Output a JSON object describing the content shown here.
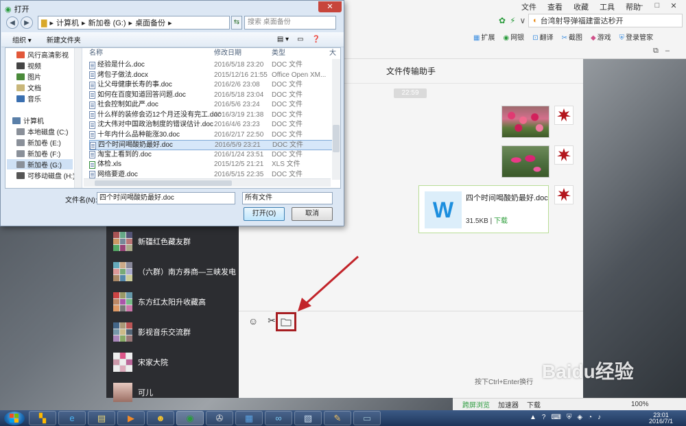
{
  "browser": {
    "menu": [
      "文件",
      "查看",
      "收藏",
      "工具",
      "帮助"
    ],
    "address": "台湾射导弹福建雷达秒开",
    "toolbar": [
      "扩展",
      "网银",
      "翻译",
      "截图",
      "游戏",
      "登录管家"
    ]
  },
  "chat": {
    "title": "文件传输助手",
    "time": "22:59",
    "file_name": "四个时间喝酸奶最好.doc",
    "file_size": "31.5KB |",
    "download": "下载",
    "hint": "按下Ctrl+Enter换行"
  },
  "contacts": [
    {
      "name": "新疆红色藏友群"
    },
    {
      "name": "（六群）南方券商—三峡发电"
    },
    {
      "name": "东方红太阳升收藏高"
    },
    {
      "name": "影视音乐交流群"
    },
    {
      "name": "宋家大院"
    },
    {
      "name": "可儿"
    }
  ],
  "dialog": {
    "title": "打开",
    "path": [
      "计算机",
      "新加卷 (G:)",
      "桌面备份"
    ],
    "search_placeholder": "搜索 桌面备份",
    "organize": "组织 ▾",
    "new_folder": "新建文件夹",
    "nav_items": [
      "风行高清影视",
      "视频",
      "图片",
      "文档",
      "音乐",
      "计算机",
      "本地磁盘 (C:)",
      "新加卷 (E:)",
      "新加卷 (F:)",
      "新加卷 (G:)",
      "可移动磁盘 (H:)"
    ],
    "columns": {
      "name": "名称",
      "date": "修改日期",
      "type": "类型",
      "size": "大"
    },
    "files": [
      {
        "name": "经验是什么.doc",
        "date": "2016/5/18 23:20",
        "type": "DOC 文件"
      },
      {
        "name": "烤包子做法.docx",
        "date": "2015/12/16 21:55",
        "type": "Office Open XM..."
      },
      {
        "name": "让父母健康长寿的事.doc",
        "date": "2016/2/6 23:08",
        "type": "DOC 文件"
      },
      {
        "name": "如何在百度知道回答问题.doc",
        "date": "2016/5/18 23:04",
        "type": "DOC 文件"
      },
      {
        "name": "社会控制如此严.doc",
        "date": "2016/5/6 23:24",
        "type": "DOC 文件"
      },
      {
        "name": "什么样的装修会迈12个月还没有完工.doc",
        "date": "2016/3/19 21:38",
        "type": "DOC 文件"
      },
      {
        "name": "沈大伟对中国政治制度的错误估计.doc",
        "date": "2016/4/6 23:23",
        "type": "DOC 文件"
      },
      {
        "name": "十年内什么品种能涨30.doc",
        "date": "2016/2/17 22:50",
        "type": "DOC 文件"
      },
      {
        "name": "四个时间喝酸奶最好.doc",
        "date": "2016/5/9 23:21",
        "type": "DOC 文件"
      },
      {
        "name": "淘宝上看到的.doc",
        "date": "2016/1/24 23:51",
        "type": "DOC 文件"
      },
      {
        "name": "体检.xls",
        "date": "2015/12/5 21:21",
        "type": "XLS 文件"
      },
      {
        "name": "网络要遊.doc",
        "date": "2016/5/15 22:35",
        "type": "DOC 文件"
      }
    ],
    "filename_label": "文件名(N):",
    "filename_value": "四个时间喝酸奶最好.doc",
    "filter": "所有文件",
    "open": "打开(O)",
    "cancel": "取消"
  },
  "status": [
    "跨屏浏览",
    "加速器",
    "下载",
    "100%"
  ],
  "taskbar": {
    "time": "23:01",
    "date": "2016/7/1"
  },
  "watermark": "Baidu经验"
}
